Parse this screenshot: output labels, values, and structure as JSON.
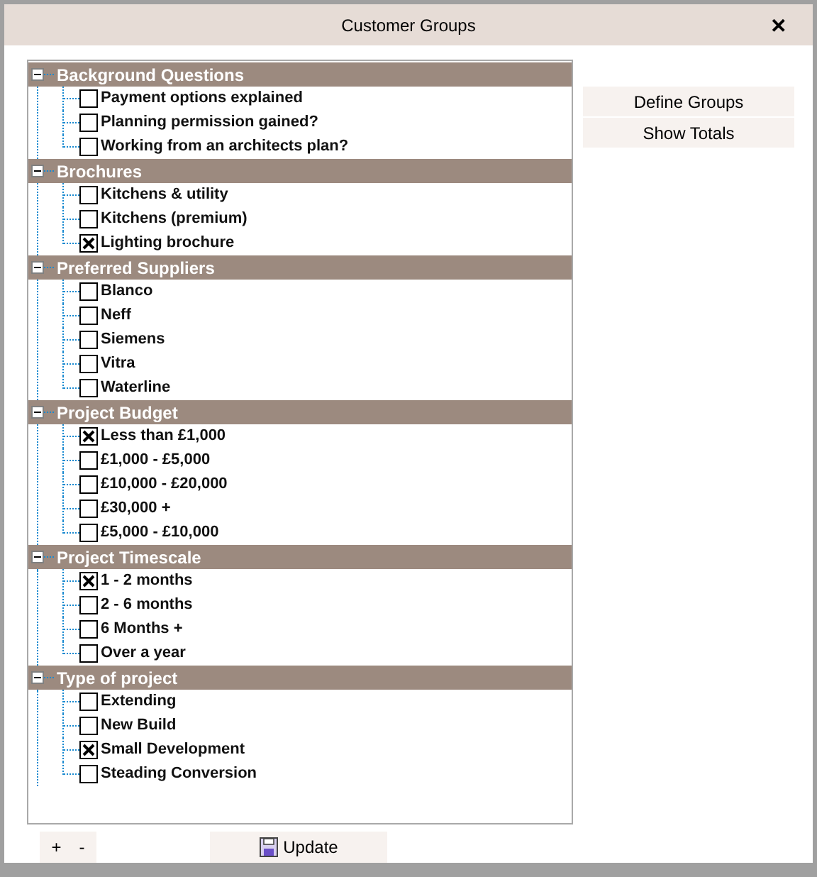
{
  "window": {
    "title": "Customer Groups",
    "close": "✕"
  },
  "groups": [
    {
      "label": "Background Questions",
      "expanded": true,
      "items": [
        {
          "label": "Payment options explained",
          "checked": false
        },
        {
          "label": "Planning permission gained?",
          "checked": false
        },
        {
          "label": "Working from an architects plan?",
          "checked": false
        }
      ]
    },
    {
      "label": "Brochures",
      "expanded": true,
      "items": [
        {
          "label": "Kitchens & utility",
          "checked": false
        },
        {
          "label": "Kitchens (premium)",
          "checked": false
        },
        {
          "label": "Lighting brochure",
          "checked": true
        }
      ]
    },
    {
      "label": "Preferred Suppliers",
      "expanded": true,
      "items": [
        {
          "label": "Blanco",
          "checked": false
        },
        {
          "label": "Neff",
          "checked": false
        },
        {
          "label": "Siemens",
          "checked": false
        },
        {
          "label": "Vitra",
          "checked": false
        },
        {
          "label": "Waterline",
          "checked": false
        }
      ]
    },
    {
      "label": "Project Budget",
      "expanded": true,
      "items": [
        {
          "label": "Less than £1,000",
          "checked": true
        },
        {
          "label": "£1,000 - £5,000",
          "checked": false
        },
        {
          "label": "£10,000 - £20,000",
          "checked": false
        },
        {
          "label": "£30,000 +",
          "checked": false
        },
        {
          "label": "£5,000 - £10,000",
          "checked": false
        }
      ]
    },
    {
      "label": "Project Timescale",
      "expanded": true,
      "items": [
        {
          "label": "1 - 2 months",
          "checked": true
        },
        {
          "label": "2 - 6 months",
          "checked": false
        },
        {
          "label": "6 Months +",
          "checked": false
        },
        {
          "label": "Over a year",
          "checked": false
        }
      ]
    },
    {
      "label": "Type of project",
      "expanded": true,
      "items": [
        {
          "label": "Extending",
          "checked": false
        },
        {
          "label": "New Build",
          "checked": false
        },
        {
          "label": "Small Development",
          "checked": true
        },
        {
          "label": "Steading Conversion",
          "checked": false
        }
      ]
    }
  ],
  "side_buttons": [
    "Define Groups",
    "Show Totals"
  ],
  "footer": {
    "add": "+",
    "remove": "-",
    "update": "Update"
  }
}
